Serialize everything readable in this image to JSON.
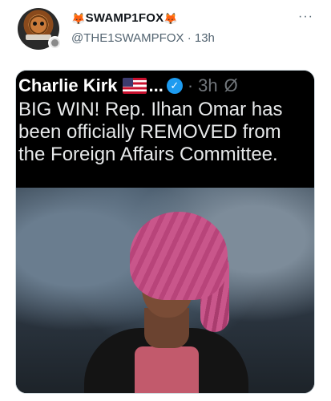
{
  "post": {
    "display_name": "SWAMP1FOX",
    "fox_emoji": "🦊",
    "handle": "@THE1SWAMPFOX",
    "separator": "·",
    "time": "13h",
    "more_icon": "more-horizontal-icon"
  },
  "media": {
    "inner_name": "Charlie Kirk",
    "inner_ellipsis": "...",
    "inner_separator": "·",
    "inner_time": "3h",
    "inner_no_symbol": "Ø",
    "tweet_text": "BIG WIN! Rep. Ilhan Omar has been officially REMOVED from the Foreign Affairs Committee."
  },
  "colors": {
    "verified_blue": "#1d9bf0",
    "muted": "#536471"
  }
}
